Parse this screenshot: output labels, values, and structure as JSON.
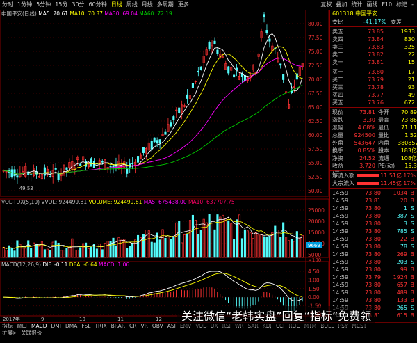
{
  "toolbar": {
    "left": [
      "分时",
      "1分钟",
      "5分钟",
      "15分",
      "30分",
      "60分钟",
      "日线",
      "周线",
      "月线",
      "多周期",
      "更多"
    ],
    "active_index": 6,
    "right": [
      "复权",
      "叠加",
      "统计",
      "画线",
      "F10",
      "标记",
      "-"
    ]
  },
  "price_panel": {
    "stock_title": "中国平安(日线)",
    "ma5": "MA5: 70.61",
    "ma10": "MA10: 70.37",
    "ma30": "MA30: 69.04",
    "ma60": "MA60: 72.19",
    "hi_label": "81.28",
    "lo_label": "49.53",
    "axis": [
      "80.00",
      "77.50",
      "75.00",
      "72.50",
      "70.00",
      "67.50",
      "65.00",
      "62.50",
      "60.00",
      "57.50",
      "55.00",
      "52.50",
      "50.00"
    ]
  },
  "vol_panel": {
    "title": "VOL-TDX(5,10)",
    "vvol": "VVOL: 924499.81",
    "volume": "VOLUME: 924499.81",
    "ma5": "MA5: 675438.00",
    "ma10": "MA10: 637707.75",
    "axis": [
      "25000",
      "20000",
      "15000",
      "10000",
      "5000"
    ],
    "tag": "9669",
    "unit": "×100"
  },
  "macd_panel": {
    "title": "MACD(12,26,9)",
    "dif": "DIF: -0.11",
    "dea": "DEA: -0.64",
    "macd": "MACD: 1.06",
    "axis": [
      "4.50",
      "3.00",
      "1.50",
      "0.00",
      "-1.50",
      "-3.00"
    ]
  },
  "date_axis": [
    "2017年",
    "9",
    "10",
    "11",
    "12",
    "18",
    "11",
    "12"
  ],
  "bottom_tabs": [
    "指标",
    "窗口",
    "MACD",
    "DMI",
    "DMA",
    "FSL",
    "TRIX",
    "BRAR",
    "CR",
    "VR",
    "OBV",
    "ASI",
    "EMV",
    "VOL-TDX",
    "RSI",
    "WR",
    "SAR",
    "KDJ",
    "CCI",
    "ROC",
    "MTM",
    "BOLL",
    "PSY",
    "MCST"
  ],
  "bottom_row2": [
    "扩展>",
    "关联报价"
  ],
  "quote": {
    "code": "601318",
    "name": "中国平安",
    "weibi_label": "委比",
    "weibi": "-41.17%",
    "weicha_label": "委差",
    "sells": [
      {
        "label": "卖五",
        "price": "73.85",
        "vol": "1933"
      },
      {
        "label": "卖四",
        "price": "73.84",
        "vol": "830"
      },
      {
        "label": "卖三",
        "price": "73.83",
        "vol": "325"
      },
      {
        "label": "卖二",
        "price": "73.82",
        "vol": "22"
      },
      {
        "label": "卖一",
        "price": "73.81",
        "vol": "15"
      }
    ],
    "buys": [
      {
        "label": "买一",
        "price": "73.80",
        "vol": "17"
      },
      {
        "label": "买二",
        "price": "73.79",
        "vol": "21"
      },
      {
        "label": "买三",
        "price": "73.78",
        "vol": "93"
      },
      {
        "label": "买四",
        "price": "73.77",
        "vol": "49"
      },
      {
        "label": "买五",
        "price": "73.76",
        "vol": "672"
      }
    ],
    "stats": [
      [
        "现价",
        "73.81",
        "今开",
        "70.89"
      ],
      [
        "涨跌",
        "3.30",
        "最高",
        "73.86"
      ],
      [
        "涨幅",
        "4.68%",
        "最低",
        "71.11"
      ],
      [
        "总量",
        "924500",
        "量比",
        "1.52"
      ],
      [
        "外盘",
        "543647",
        "内盘",
        "380852"
      ],
      [
        "换手",
        "0.85%",
        "股本",
        "183亿"
      ],
      [
        "净资",
        "24.52",
        "流通",
        "108亿"
      ],
      [
        "收益(三)",
        "3.720",
        "PE(动)",
        "15.3"
      ]
    ],
    "flows": [
      {
        "label": "净流入额",
        "value": "11.51亿",
        "pct": "17%"
      },
      {
        "label": "大宗流入",
        "value": "11.45亿",
        "pct": "17%"
      }
    ],
    "ticks": [
      [
        "14:59",
        "73.80",
        "1034",
        "B"
      ],
      [
        "14:59",
        "73.81",
        "20",
        "B"
      ],
      [
        "14:59",
        "73.80",
        "1",
        "S"
      ],
      [
        "14:59",
        "73.80",
        "387",
        "S"
      ],
      [
        "14:59",
        "73.80",
        "3",
        "S"
      ],
      [
        "14:59",
        "73.80",
        "785",
        "S"
      ],
      [
        "14:59",
        "73.80",
        "22",
        "B"
      ],
      [
        "14:59",
        "73.80",
        "78",
        "S"
      ],
      [
        "14:59",
        "73.80",
        "269",
        "B"
      ],
      [
        "14:59",
        "73.80",
        "203",
        "S"
      ],
      [
        "14:59",
        "73.80",
        "99",
        "B"
      ],
      [
        "14:59",
        "73.79",
        "1924",
        "B"
      ],
      [
        "14:59",
        "73.80",
        "657",
        "B"
      ],
      [
        "14:59",
        "73.80",
        "489",
        "B"
      ],
      [
        "14:59",
        "73.80",
        "133",
        "B"
      ],
      [
        "14:59",
        "73.80",
        "265",
        "S"
      ],
      [
        "14:59",
        "73.81",
        "615",
        "B"
      ]
    ]
  },
  "watermark": {
    "text": "关注微信",
    "q1": "“老韩实盘”",
    "mid": "回复",
    "q2": "“指标”",
    "tail": "免费领"
  },
  "colors": {
    "up": "#ff3232",
    "down": "#54fcfc",
    "ma5": "#ffffff",
    "ma10": "#ffff00",
    "ma30": "#ff00ff",
    "ma60": "#00cc00",
    "grid": "#800000"
  }
}
